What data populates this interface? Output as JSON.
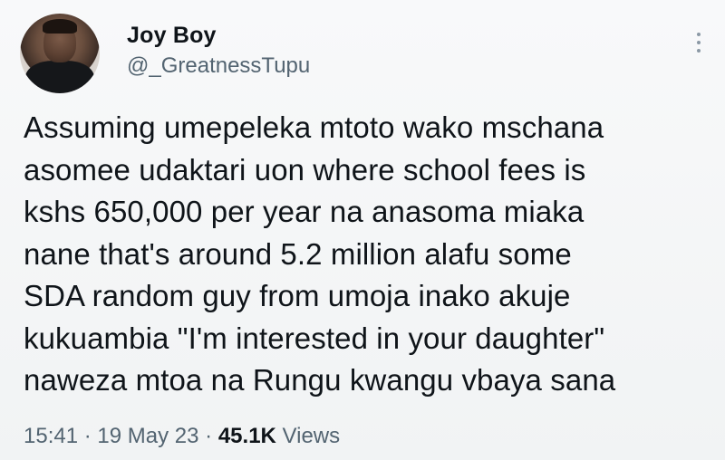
{
  "author": {
    "display_name": "Joy Boy",
    "handle": "@_GreatnessTupu"
  },
  "tweet": {
    "lines": [
      "Assuming umepeleka mtoto wako mschana",
      "asomee udaktari uon where school fees is",
      "kshs 650,000 per year na anasoma miaka",
      "nane that's around 5.2 million alafu some",
      "SDA random guy from umoja inako akuje",
      "kukuambia \"I'm interested in your daughter\"",
      "naweza mtoa na Rungu kwangu vbaya sana"
    ]
  },
  "meta": {
    "time": "15:41",
    "separator": "·",
    "date": "19 May 23",
    "views_count": "45.1K",
    "views_label": "Views"
  },
  "icons": {
    "more": "more-vertical-icon"
  },
  "colors": {
    "text": "#0f1419",
    "secondary": "#536471",
    "background": "#f7f9f9"
  }
}
